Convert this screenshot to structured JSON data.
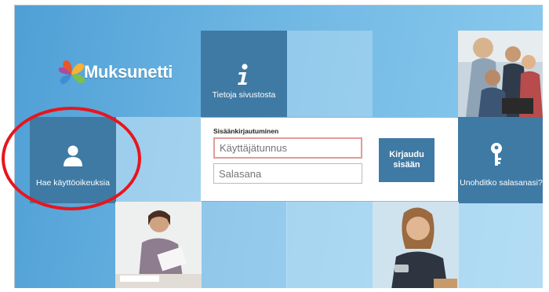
{
  "brand": {
    "name": "Muksunetti"
  },
  "tiles": {
    "info_label": "Tietoja sivustosta",
    "apply_label": "Hae käyttöoikeuksia",
    "forgot_label": "Unohditko salasanasi?"
  },
  "login": {
    "title": "Sisäänkirjautuminen",
    "username_placeholder": "Käyttäjätunnus",
    "password_placeholder": "Salasana",
    "submit_line1": "Kirjaudu",
    "submit_line2": "sisään"
  },
  "icons": {
    "info": "info-icon",
    "user": "user-icon",
    "key": "key-icon"
  },
  "colors": {
    "tile_dark": "#3f7aa4",
    "annotation": "#e8151c"
  }
}
